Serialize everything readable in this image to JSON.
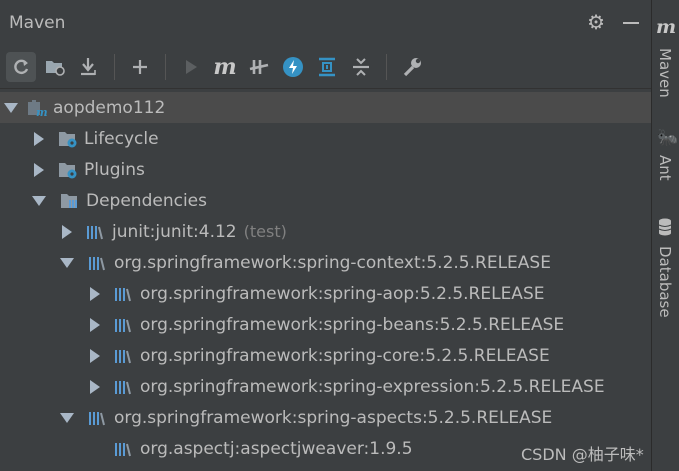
{
  "panel": {
    "title": "Maven",
    "settings_icon": "gear-icon",
    "hide_icon": "minimize-icon"
  },
  "toolbar": {
    "items": [
      {
        "name": "reload-all-icon"
      },
      {
        "name": "generate-sources-icon"
      },
      {
        "name": "download-sources-icon"
      },
      {
        "name": "add-maven-project-icon"
      },
      {
        "name": "run-icon"
      },
      {
        "name": "execute-maven-goal-icon",
        "label": "m"
      },
      {
        "name": "toggle-offline-icon"
      },
      {
        "name": "skip-tests-icon"
      },
      {
        "name": "show-dependencies-icon"
      },
      {
        "name": "collapse-all-icon"
      },
      {
        "name": "settings-wrench-icon"
      }
    ]
  },
  "tree": {
    "root": "aopdemo112",
    "lifecycle": "Lifecycle",
    "plugins": "Plugins",
    "dependencies": "Dependencies",
    "deps": [
      {
        "label": "junit:junit:4.12",
        "scope": "(test)"
      },
      {
        "label": "org.springframework:spring-context:5.2.5.RELEASE"
      },
      {
        "label": "org.springframework:spring-aop:5.2.5.RELEASE"
      },
      {
        "label": "org.springframework:spring-beans:5.2.5.RELEASE"
      },
      {
        "label": "org.springframework:spring-core:5.2.5.RELEASE"
      },
      {
        "label": "org.springframework:spring-expression:5.2.5.RELEASE"
      },
      {
        "label": "org.springframework:spring-aspects:5.2.5.RELEASE"
      },
      {
        "label": "org.aspectj:aspectjweaver:1.9.5"
      }
    ]
  },
  "side_tabs": {
    "maven_logo": "m",
    "maven": "Maven",
    "ant": "Ant",
    "database": "Database"
  },
  "watermark": "CSDN @柚子味*"
}
